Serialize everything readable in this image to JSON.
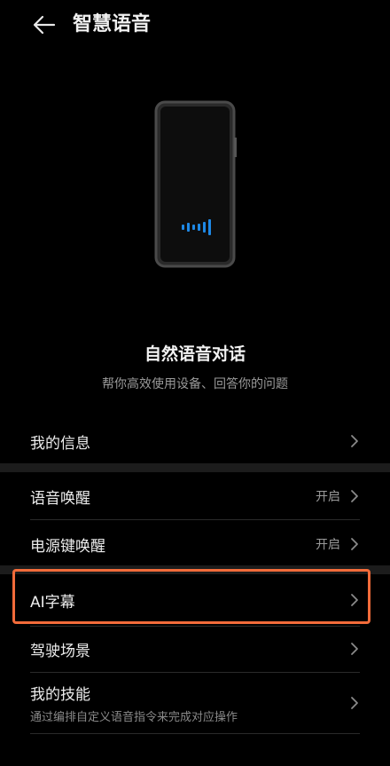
{
  "header": {
    "title": "智慧语音"
  },
  "intro": {
    "headline": "自然语音对话",
    "subhead": "帮你高效使用设备、回答你的问题"
  },
  "rows": [
    {
      "label": "我的信息",
      "value": ""
    },
    {
      "label": "语音唤醒",
      "value": "开启"
    },
    {
      "label": "电源键唤醒",
      "value": "开启"
    },
    {
      "label": "AI字幕",
      "value": ""
    },
    {
      "label": "驾驶场景",
      "value": ""
    },
    {
      "label": "我的技能",
      "value": "",
      "desc": "通过编排自定义语音指令来完成对应操作"
    }
  ],
  "colors": {
    "accent_voice": "#1e88e5",
    "highlight": "#f26b3a"
  },
  "icons": {
    "back": "arrow-left-icon",
    "chevron": "chevron-right-icon",
    "voice": "voice-wave-icon"
  }
}
